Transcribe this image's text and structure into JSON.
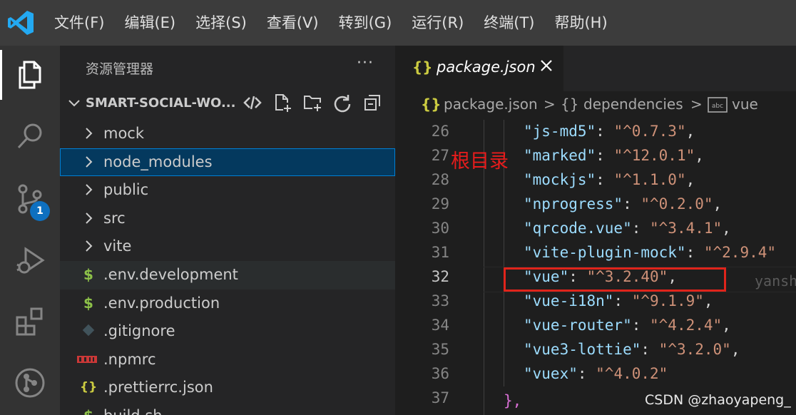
{
  "menu": [
    "文件(F)",
    "编辑(E)",
    "选择(S)",
    "查看(V)",
    "转到(G)",
    "运行(R)",
    "终端(T)",
    "帮助(H)"
  ],
  "activity": {
    "scm_badge": "1"
  },
  "sidebar": {
    "title": "资源管理器",
    "more": "···",
    "folder": "SMART-SOCIAL-WO...",
    "items": [
      {
        "label": "mock",
        "type": "folder"
      },
      {
        "label": "node_modules",
        "type": "folder",
        "selected": true
      },
      {
        "label": "public",
        "type": "folder"
      },
      {
        "label": "src",
        "type": "folder"
      },
      {
        "label": "vite",
        "type": "folder"
      },
      {
        "label": ".env.development",
        "type": "env",
        "icon_text": "$"
      },
      {
        "label": ".env.production",
        "type": "env",
        "icon_text": "$"
      },
      {
        "label": ".gitignore",
        "type": "git"
      },
      {
        "label": ".npmrc",
        "type": "npm"
      },
      {
        "label": ".prettierrc.json",
        "type": "json",
        "icon_text": "{}"
      },
      {
        "label": "build.sh",
        "type": "env",
        "icon_text": "$"
      }
    ]
  },
  "editor": {
    "tab": {
      "icon_text": "{}",
      "name": "package.json"
    },
    "breadcrumb": {
      "file_icon": "{}",
      "file": "package.json",
      "sep": ">",
      "section_icon": "{}",
      "section": "dependencies",
      "leaf": "vue"
    },
    "lines": [
      {
        "n": "26",
        "key": "\"js-md5\"",
        "val": "\"^0.7.3\"",
        "tail": ","
      },
      {
        "n": "27",
        "key": "\"marked\"",
        "val": "\"^12.0.1\"",
        "tail": ","
      },
      {
        "n": "28",
        "key": "\"mockjs\"",
        "val": "\"^1.1.0\"",
        "tail": ","
      },
      {
        "n": "29",
        "key": "\"nprogress\"",
        "val": "\"^0.2.0\"",
        "tail": ","
      },
      {
        "n": "30",
        "key": "\"qrcode.vue\"",
        "val": "\"^3.4.1\"",
        "tail": ","
      },
      {
        "n": "31",
        "key": "\"vite-plugin-mock\"",
        "val": "\"^2.9.4\"",
        "tail": ""
      },
      {
        "n": "32",
        "key": "\"vue\"",
        "val": "\"^3.2.40\"",
        "tail": ",",
        "current": true
      },
      {
        "n": "33",
        "key": "\"vue-i18n\"",
        "val": "\"^9.1.9\"",
        "tail": ","
      },
      {
        "n": "34",
        "key": "\"vue-router\"",
        "val": "\"^4.2.4\"",
        "tail": ","
      },
      {
        "n": "35",
        "key": "\"vue3-lottie\"",
        "val": "\"^3.2.0\"",
        "tail": ","
      },
      {
        "n": "36",
        "key": "\"vuex\"",
        "val": "\"^4.0.2\"",
        "tail": ""
      },
      {
        "n": "37",
        "key": "",
        "val": "",
        "tail": ""
      }
    ],
    "close_brace": "},",
    "ghost_text": "yansh",
    "annotation": "根目录"
  },
  "watermark": "CSDN @zhaoyapeng_",
  "colors": {
    "titlebar": "#3c3c3c",
    "activitybar": "#333333",
    "sidebar": "#252526",
    "editor": "#1e1e1e",
    "selection": "#04395e",
    "key": "#9cdcfe",
    "string": "#ce9178",
    "annotation": "#e81c1c",
    "badge": "#0e70c0"
  }
}
